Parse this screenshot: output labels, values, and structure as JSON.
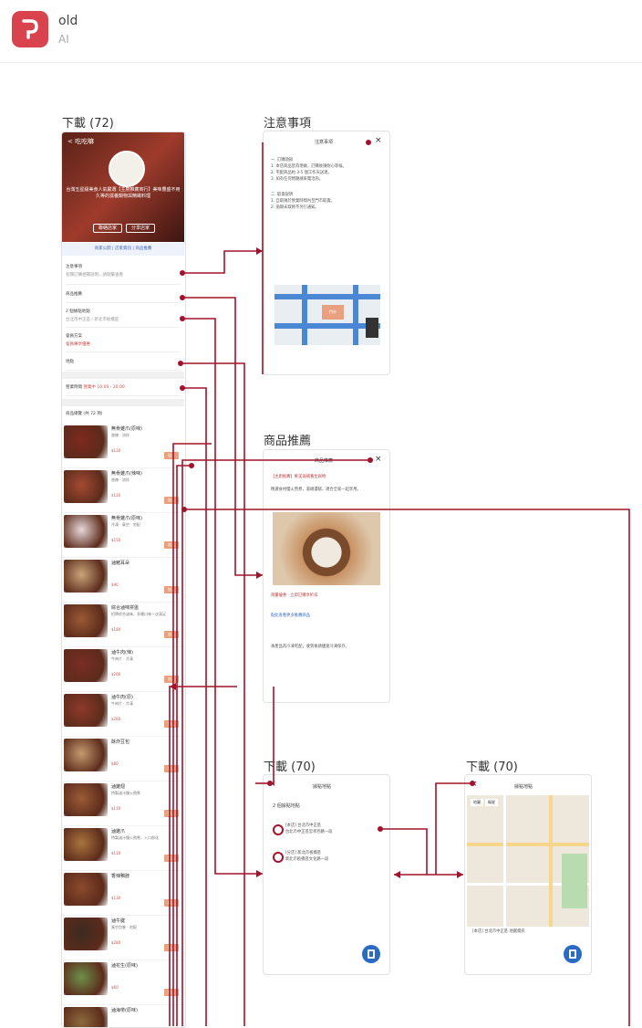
{
  "app": {
    "title": "old",
    "subtitle": "AI"
  },
  "frames": {
    "product_list": {
      "label": "下載 (72)",
      "nav_title": "< 吃吃嘛",
      "hero_caption": "台灣五星級美食人氣嚴選【主廚推薦商行】美味豐盛不用久等的滋養鍋物與精緻料理",
      "hero_buttons": [
        "聯絡店家",
        "分享店家"
      ],
      "links": "商家公開 | 店家資訊 | 商品推薦",
      "menu": [
        {
          "title": "注意事項",
          "sub": "有關訂購相關說明，請點擊查看"
        },
        {
          "title": "商品推薦",
          "sub": ""
        },
        {
          "title": "2 個據點地點",
          "sub": "台北市中正區 / 新北市板橋區"
        },
        {
          "title": "會員方案",
          "sub": "會員專享優惠"
        },
        {
          "title": "地點",
          "sub": ""
        },
        {
          "title": "營業時間",
          "sub": "營業中 10:00 - 20:00"
        }
      ],
      "section_title": "商品總覽 (共 72 項)",
      "products": [
        {
          "name": "無骨雞爪(原味)",
          "desc": "香辣 · 涼拌",
          "price": "$120"
        },
        {
          "name": "無骨雞爪(辣味)",
          "desc": "香辣 · 涼拌",
          "price": "$120"
        },
        {
          "name": "無骨雞爪(原味)",
          "desc": "冷凍 · 真空 · 宅配",
          "price": "$150"
        },
        {
          "name": "滷豬耳朵",
          "desc": "",
          "price": "$90"
        },
        {
          "name": "綜合滷味拼盤",
          "desc": "招牌綜合滷味，多種口味一次滿足",
          "price": "$180"
        },
        {
          "name": "滷牛肉(辣)",
          "desc": "牛肉片 · 冷凍",
          "price": "$260"
        },
        {
          "name": "滷牛肉(原)",
          "desc": "牛肉片 · 冷凍",
          "price": "$260"
        },
        {
          "name": "酥炸豆包",
          "desc": "",
          "price": "$80"
        },
        {
          "name": "滷雞翅",
          "desc": "特製滷汁慢火熬煮",
          "price": "$110"
        },
        {
          "name": "滷雞爪",
          "desc": "特製滷汁慢火熬煮，入口即化",
          "price": "$110"
        },
        {
          "name": "香辣鴨脖",
          "desc": "",
          "price": "$130"
        },
        {
          "name": "滷牛腱",
          "desc": "真空包裝 · 宅配",
          "price": "$280"
        },
        {
          "name": "滷花生(原味)",
          "desc": "",
          "price": "$60"
        },
        {
          "name": "滷海帶(原味)",
          "desc": "",
          "price": "$60"
        }
      ],
      "add_button": "加入"
    },
    "notice": {
      "label": "注意事項",
      "header": "注意事項",
      "close": "×",
      "text": [
        "一. 訂購須知",
        "1. 本店商品皆為現做，訂購後請耐心等候。",
        "2. 宅配商品約 3-5 個工作天送達。",
        "3. 如有任何問題請來電洽詢。",
        "二. 取貨說明",
        "1. 自取請於營業時間內至門市取貨。",
        "2. 逾期未取將不另行通知。"
      ],
      "map_label": "門市"
    },
    "recommend": {
      "label": "商品推薦",
      "header": "商品推薦",
      "close": "×",
      "headline": "【主廚推薦】鮮美滋補養生鍋物",
      "body": "精選食材慢火熬煮，湯頭濃郁，適合全家一起享用。",
      "highlight": "限量優惠 · 立即訂購享折扣",
      "link_text": "點此查看更多推薦商品",
      "footer_text": "本產品為冷凍宅配，收到後請儘速冷凍保存。"
    },
    "branches_a": {
      "label": "下載 (70)",
      "header": "據點地點",
      "close": "×",
      "count": "2 個據點地點",
      "branches": [
        {
          "name": "[本店] 台北市中正區",
          "addr": "台北市中正區忠孝西路一段"
        },
        {
          "name": "[分店] 新北市板橋區",
          "addr": "新北市板橋區文化路一段"
        }
      ]
    },
    "branches_b": {
      "label": "下載 (70)",
      "header": "據點地點",
      "close": "×",
      "tabs": [
        "地圖",
        "衛星"
      ],
      "caption": "[本店] 台北市中正區 地圖資訊"
    }
  },
  "colors": {
    "connector": "#a3122a",
    "brand": "#d9434e",
    "accent_button": "#e9a07f",
    "fab": "#2a6bc4"
  }
}
